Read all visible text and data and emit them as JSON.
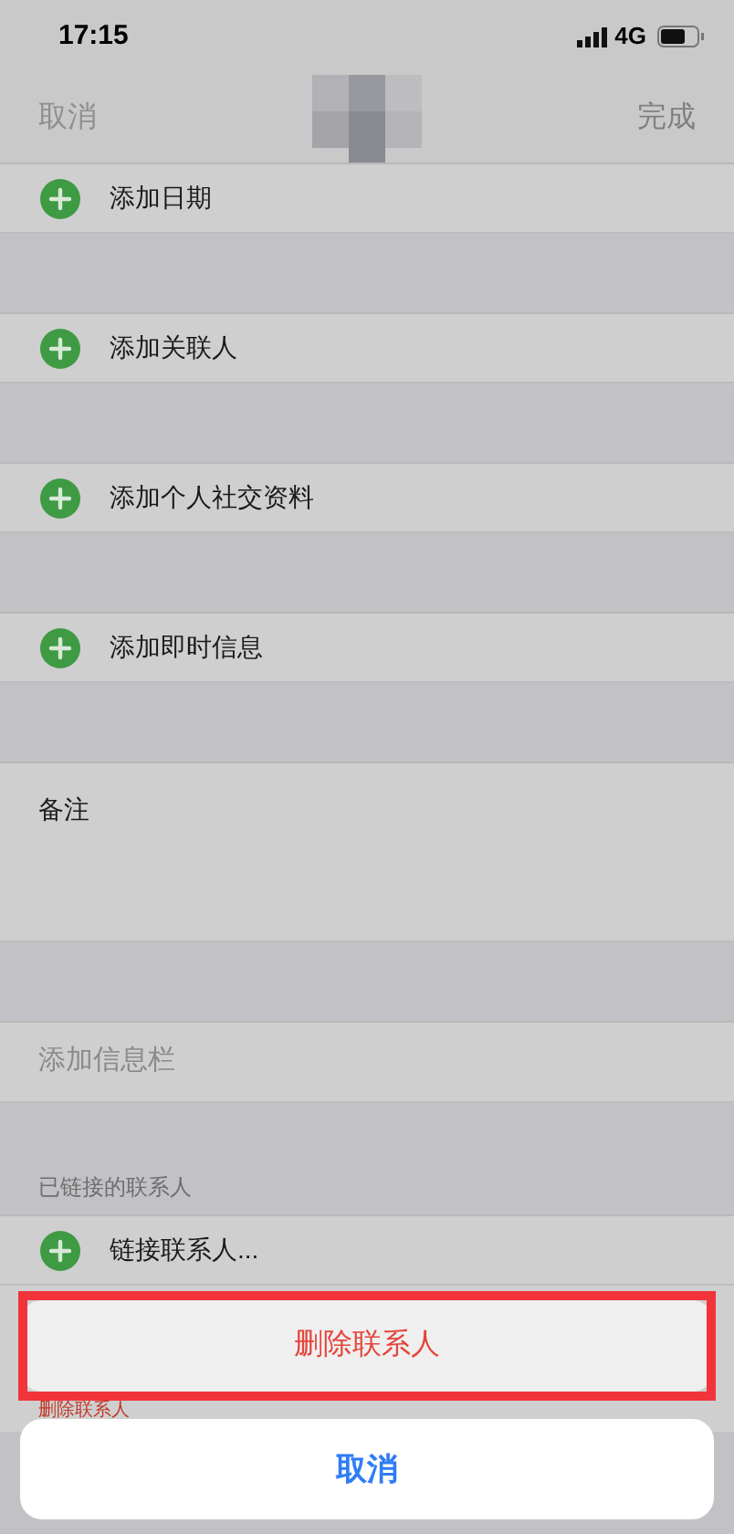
{
  "status_bar": {
    "time": "17:15",
    "network": "4G"
  },
  "nav": {
    "cancel": "取消",
    "done": "完成",
    "done_disabled": true
  },
  "rows": [
    {
      "kind": "add",
      "label": "添加日期"
    },
    {
      "kind": "gap"
    },
    {
      "kind": "add",
      "label": "添加关联人"
    },
    {
      "kind": "gap"
    },
    {
      "kind": "add",
      "label": "添加个人社交资料"
    },
    {
      "kind": "gap"
    },
    {
      "kind": "add",
      "label": "添加即时信息"
    },
    {
      "kind": "gap"
    },
    {
      "kind": "notes",
      "label": "备注"
    },
    {
      "kind": "gap"
    },
    {
      "kind": "plain",
      "label": "添加信息栏"
    },
    {
      "kind": "header",
      "label": "已链接的联系人"
    },
    {
      "kind": "add",
      "label": "链接联系人..."
    },
    {
      "kind": "peek",
      "label": "删除联系人"
    }
  ],
  "action_sheet": {
    "actions": [
      {
        "label": "删除联系人",
        "highlighted": true
      }
    ],
    "cancel": "取消"
  }
}
